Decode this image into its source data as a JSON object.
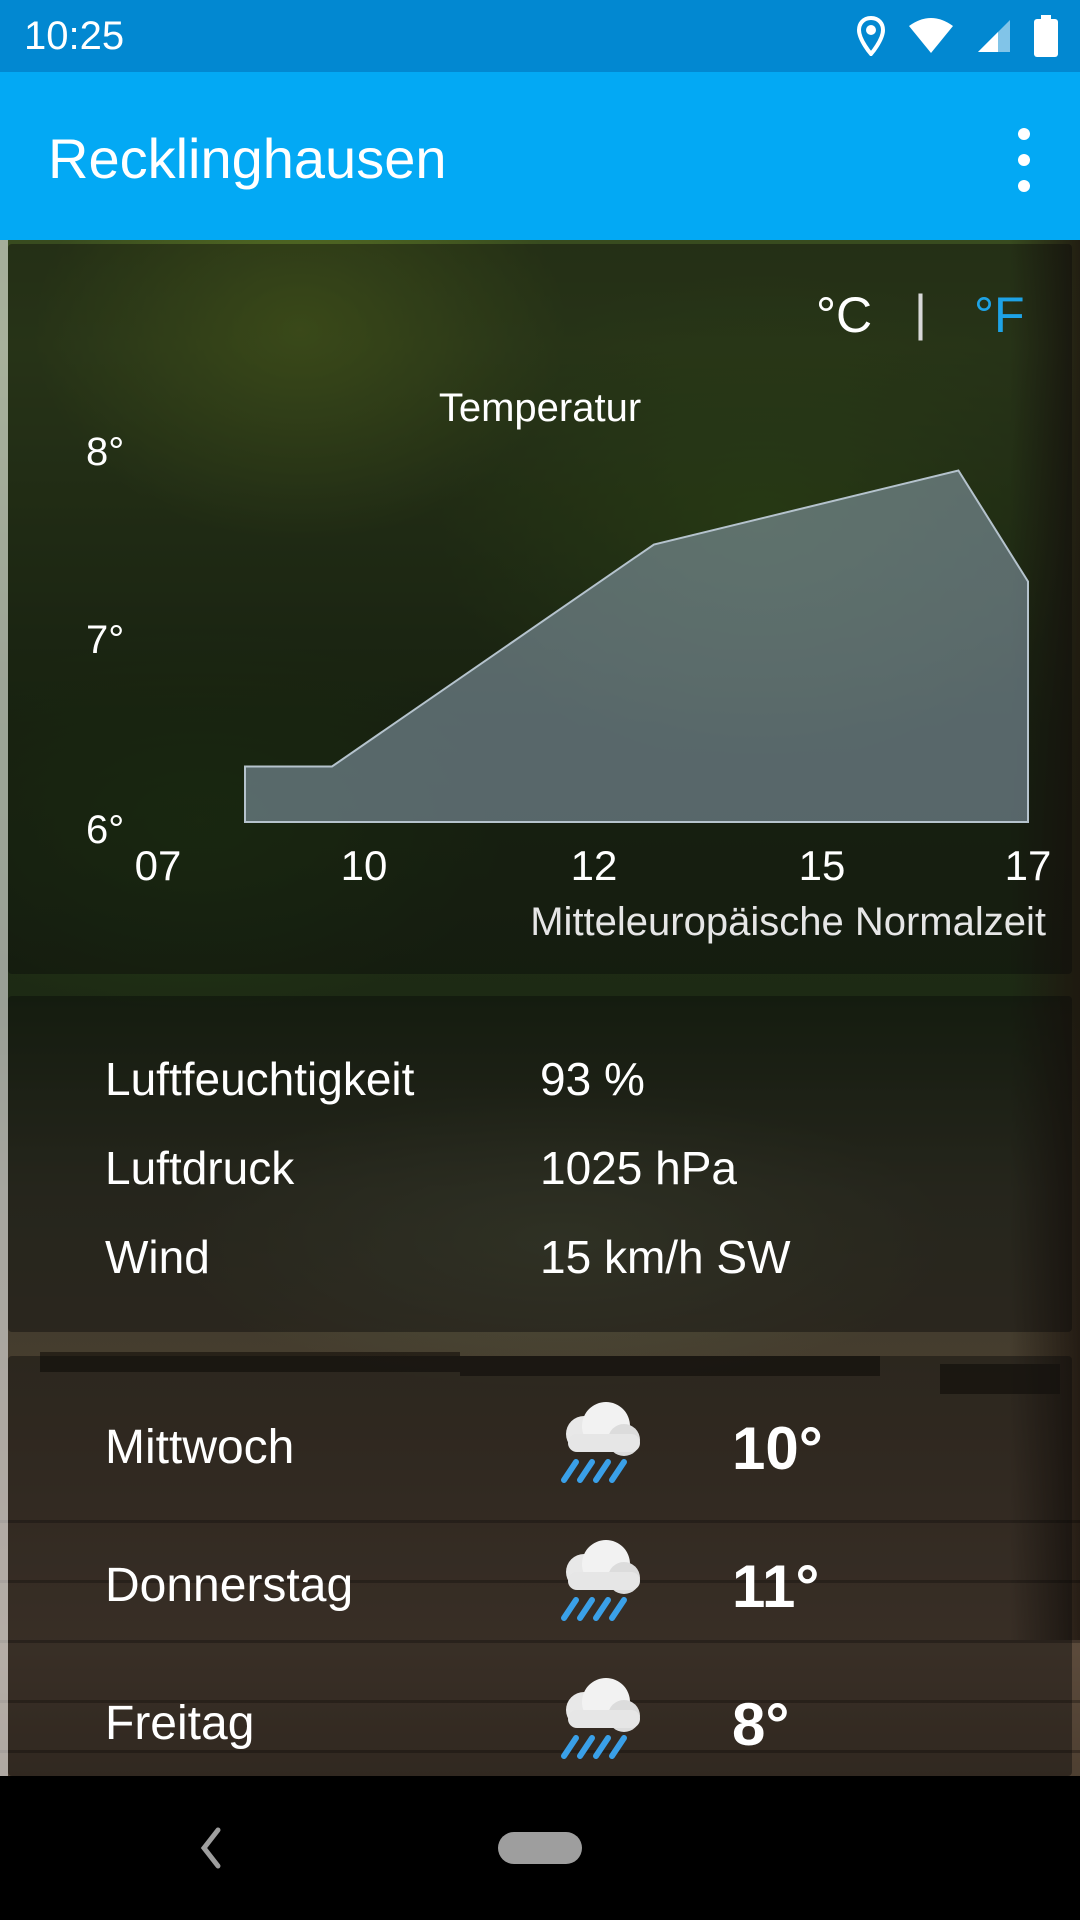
{
  "status_bar": {
    "time": "10:25",
    "icons": [
      "location-icon",
      "wifi-icon",
      "signal-icon",
      "battery-icon"
    ]
  },
  "app_bar": {
    "title": "Recklinghausen",
    "menu_icon": "more-vert-icon"
  },
  "units": {
    "celsius": "°C",
    "separator": "|",
    "fahrenheit": "°F",
    "active": "celsius",
    "active_color": "#ffffff",
    "inactive_color": "#1ea3e6"
  },
  "chart_data": {
    "type": "area",
    "title": "Temperatur",
    "x": [
      8.0,
      9.0,
      12.7,
      16.2,
      17.0
    ],
    "x_tick_labels": [
      "07",
      "10",
      "12",
      "15",
      "17"
    ],
    "x_ticks": [
      7,
      10,
      12,
      15,
      17
    ],
    "y": [
      6.3,
      6.3,
      7.5,
      7.9,
      7.3
    ],
    "y_tick_labels": [
      "8°",
      "7°",
      "6°"
    ],
    "ylim": [
      6,
      8
    ],
    "xlabel": "Mitteleuropäische Normalzeit",
    "fill_color": "#8ea3b4"
  },
  "details": [
    {
      "label": "Luftfeuchtigkeit",
      "value": "93 %"
    },
    {
      "label": "Luftdruck",
      "value": "1025 hPa"
    },
    {
      "label": "Wind",
      "value": "15 km/h SW"
    }
  ],
  "forecast": [
    {
      "day": "Mittwoch",
      "icon": "rain-cloud-icon",
      "temp": "10°"
    },
    {
      "day": "Donnerstag",
      "icon": "rain-cloud-icon",
      "temp": "11°"
    },
    {
      "day": "Freitag",
      "icon": "rain-cloud-icon",
      "temp": "8°"
    }
  ],
  "nav_bar": {
    "back_icon": "back-icon",
    "home_icon": "home-pill-icon"
  },
  "colors": {
    "status_bar": "#0288d1",
    "app_bar": "#03a9f4"
  }
}
